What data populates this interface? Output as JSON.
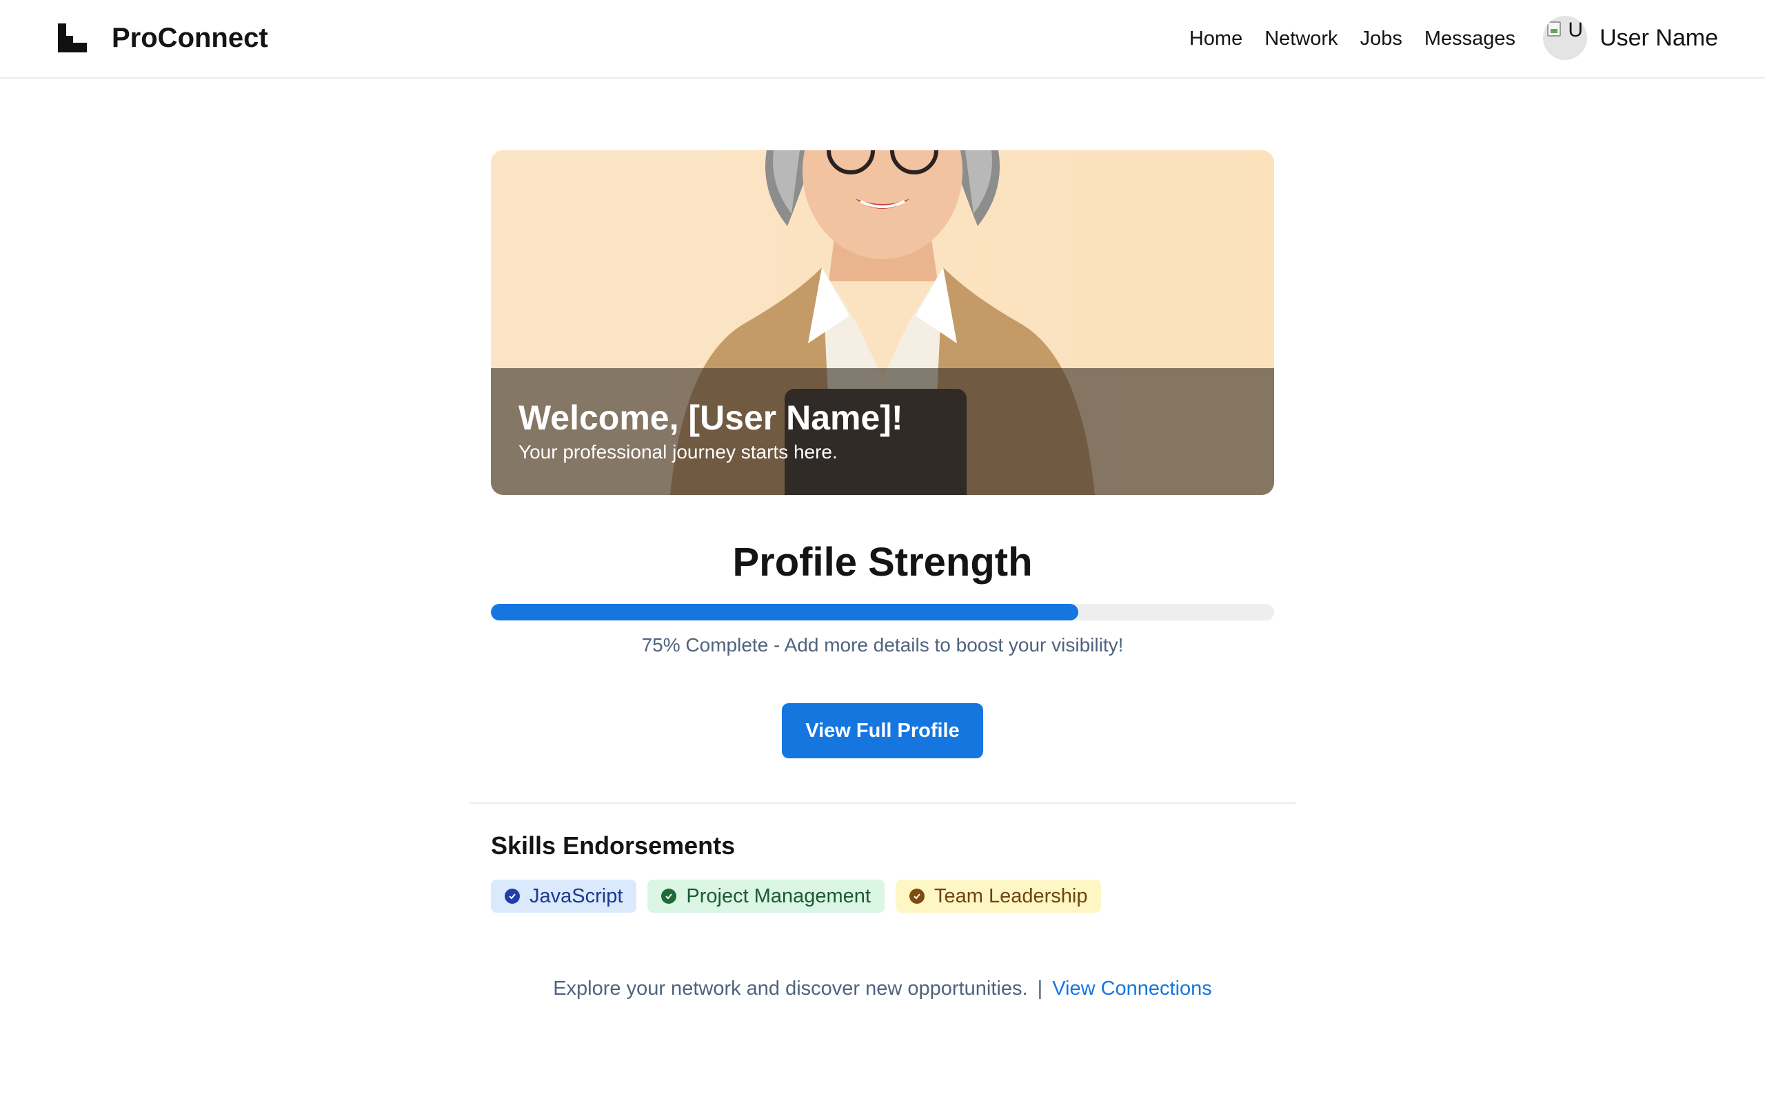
{
  "app": {
    "brand": "ProConnect",
    "logo_icon": "stair-logo-icon"
  },
  "nav": {
    "items": [
      "Home",
      "Network",
      "Jobs",
      "Messages"
    ]
  },
  "user": {
    "avatar_alt": "U",
    "name": "User Name"
  },
  "hero": {
    "title": "Welcome, [User Name]!",
    "subtitle": "Your professional journey starts here.",
    "illustration": "smiling-elderly-woman-with-glasses-holding-tablet"
  },
  "profile_strength": {
    "title": "Profile Strength",
    "percent": 75,
    "note": "75% Complete - Add more details to boost your visibility!",
    "button_label": "View Full Profile"
  },
  "skills": {
    "title": "Skills Endorsements",
    "items": [
      {
        "label": "JavaScript",
        "icon": "check-circle-icon",
        "color": "#dbe9fc"
      },
      {
        "label": "Project Management",
        "icon": "check-circle-icon",
        "color": "#dbf6e4"
      },
      {
        "label": "Team Leadership",
        "icon": "check-circle-icon",
        "color": "#fef6c5"
      }
    ]
  },
  "footer": {
    "text": "Explore your network and discover new opportunities.",
    "separator": "|",
    "link_label": "View Connections"
  },
  "colors": {
    "accent": "#1576e0",
    "muted_text": "#4f637d"
  }
}
